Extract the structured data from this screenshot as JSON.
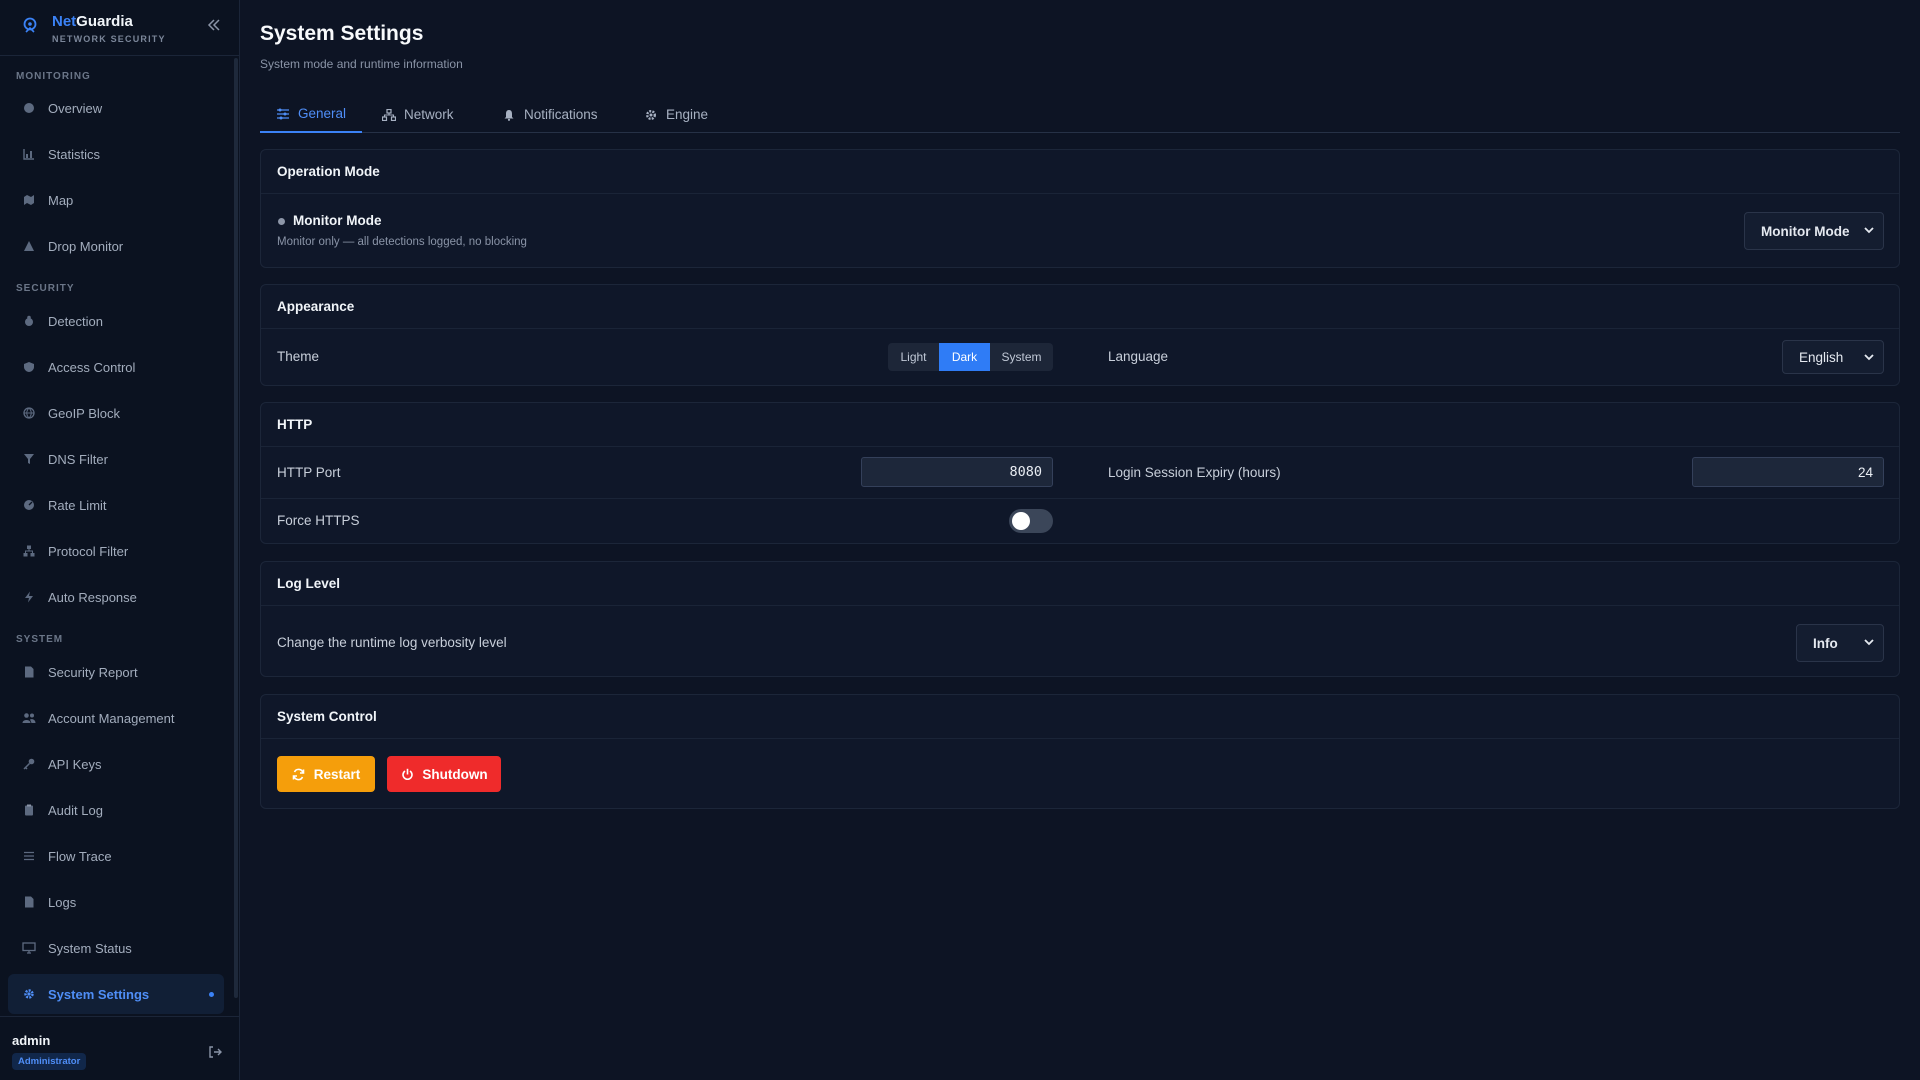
{
  "brand": {
    "name_part1": "Net",
    "name_part2": "Guardia",
    "tagline": "NETWORK SECURITY"
  },
  "sidebar": {
    "sections": [
      {
        "title": "MONITORING",
        "items": [
          {
            "label": "Overview",
            "icon": "gauge-icon"
          },
          {
            "label": "Statistics",
            "icon": "chart-icon"
          },
          {
            "label": "Map",
            "icon": "map-icon"
          },
          {
            "label": "Drop Monitor",
            "icon": "warning-icon"
          }
        ]
      },
      {
        "title": "SECURITY",
        "items": [
          {
            "label": "Detection",
            "icon": "bug-icon"
          },
          {
            "label": "Access Control",
            "icon": "shield-icon"
          },
          {
            "label": "GeoIP Block",
            "icon": "globe-icon"
          },
          {
            "label": "DNS Filter",
            "icon": "filter-icon"
          },
          {
            "label": "Rate Limit",
            "icon": "speed-icon"
          },
          {
            "label": "Protocol Filter",
            "icon": "network-icon"
          },
          {
            "label": "Auto Response",
            "icon": "bolt-icon"
          }
        ]
      },
      {
        "title": "SYSTEM",
        "items": [
          {
            "label": "Security Report",
            "icon": "document-icon"
          },
          {
            "label": "Account Management",
            "icon": "users-icon"
          },
          {
            "label": "API Keys",
            "icon": "key-icon"
          },
          {
            "label": "Audit Log",
            "icon": "clipboard-icon"
          },
          {
            "label": "Flow Trace",
            "icon": "list-icon"
          },
          {
            "label": "Logs",
            "icon": "file-icon"
          },
          {
            "label": "System Status",
            "icon": "monitor-icon"
          },
          {
            "label": "System Settings",
            "icon": "gear-icon",
            "active": true
          }
        ]
      }
    ]
  },
  "user": {
    "name": "admin",
    "role": "Administrator"
  },
  "header": {
    "title": "System Settings",
    "subtitle": "System mode and runtime information"
  },
  "tabs": [
    {
      "label": "General",
      "icon": "sliders-icon",
      "active": true
    },
    {
      "label": "Network",
      "icon": "network-icon"
    },
    {
      "label": "Notifications",
      "icon": "bell-icon"
    },
    {
      "label": "Engine",
      "icon": "gear-icon"
    }
  ],
  "operation_mode": {
    "title": "Operation Mode",
    "mode_name": "Monitor Mode",
    "mode_desc": "Monitor only — all detections logged, no blocking",
    "selected": "Monitor Mode"
  },
  "appearance": {
    "title": "Appearance",
    "theme_label": "Theme",
    "theme_options": [
      "Light",
      "Dark",
      "System"
    ],
    "theme_selected": "Dark",
    "language_label": "Language",
    "language_selected": "English"
  },
  "http": {
    "title": "HTTP",
    "port_label": "HTTP Port",
    "port_value": "8080",
    "session_label": "Login Session Expiry (hours)",
    "session_value": "24",
    "https_label": "Force HTTPS",
    "https_enabled": false
  },
  "log_level": {
    "title": "Log Level",
    "desc": "Change the runtime log verbosity level",
    "selected": "Info"
  },
  "system_control": {
    "title": "System Control",
    "restart_label": "Restart",
    "shutdown_label": "Shutdown",
    "restart_color": "#f59e0b",
    "shutdown_color": "#ef2b2b"
  },
  "colors": {
    "accent": "#3b82f6",
    "background": "#0d1424",
    "sidebar": "#0b1220",
    "card": "#0f1729"
  }
}
